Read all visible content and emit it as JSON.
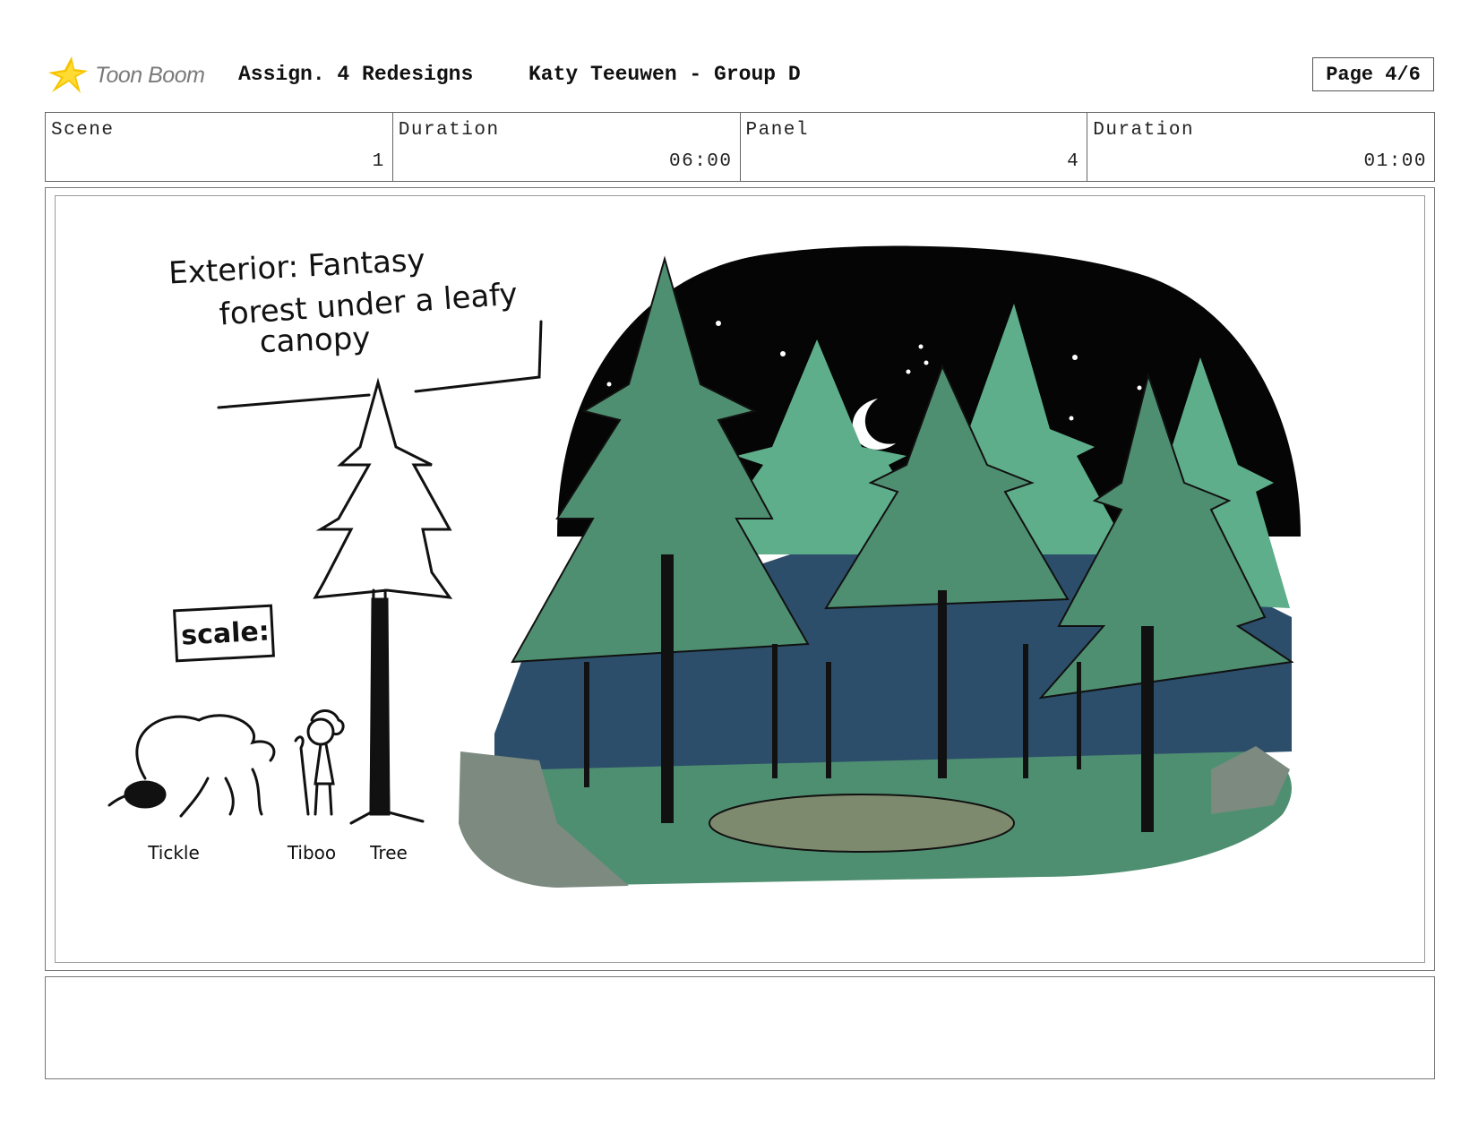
{
  "header": {
    "logo_text": "Toon Boom",
    "project_title": "Assign. 4 Redesigns",
    "author": "Katy Teeuwen - Group D",
    "page_label": "Page 4/6"
  },
  "info": {
    "scene_label": "Scene",
    "scene_value": "1",
    "scene_duration_label": "Duration",
    "scene_duration_value": "06:00",
    "panel_label": "Panel",
    "panel_value": "4",
    "panel_duration_label": "Duration",
    "panel_duration_value": "01:00"
  },
  "panel": {
    "caption_line1": "Exterior: Fantasy",
    "caption_line2": "forest under a leafy",
    "caption_line3": "canopy",
    "scale_label": "scale:",
    "characters": [
      "Tickle",
      "Tiboo",
      "Tree"
    ]
  },
  "colors": {
    "sky": "#050505",
    "pine_green": "#4f8f71",
    "light_green": "#5fae8b",
    "blue_shadow": "#2c4e6a",
    "clearing": "#7e8a6e",
    "rock_grey": "#7c8a80"
  },
  "icons": {
    "logo": "toon-boom-star-icon",
    "moon": "crescent-moon-icon"
  }
}
